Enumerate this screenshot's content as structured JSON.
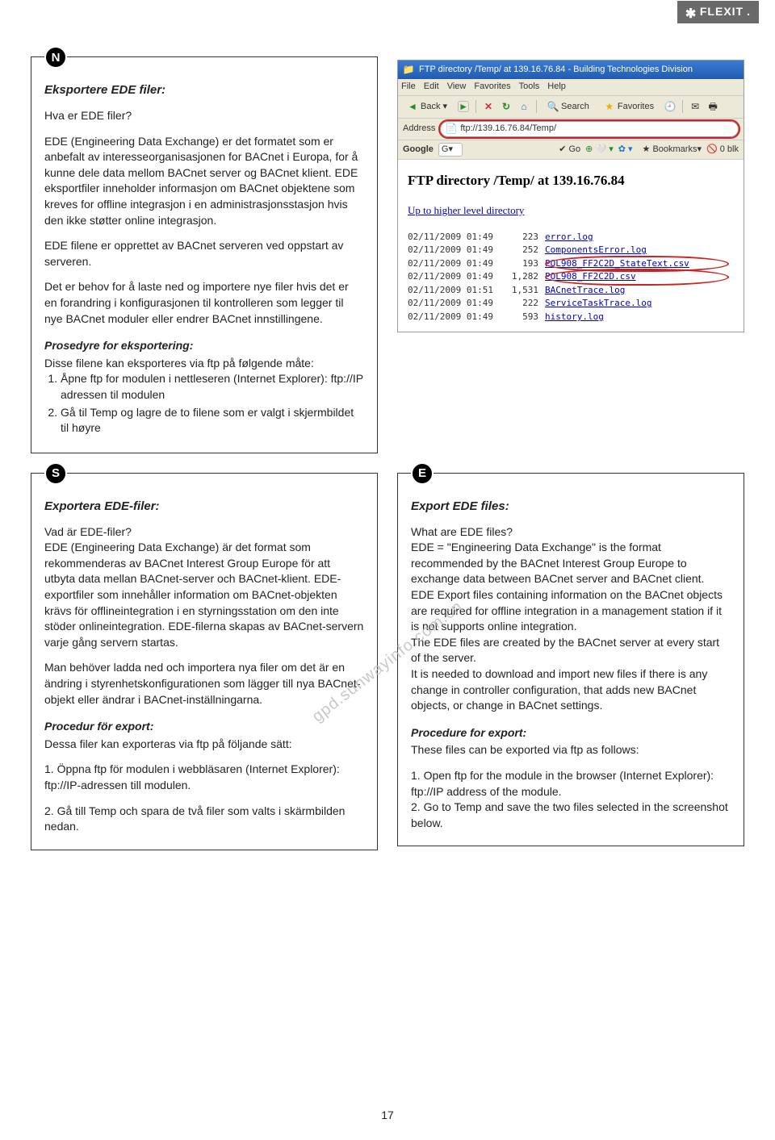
{
  "brand": "FLEXIT",
  "page_number": "17",
  "watermark": "gpd.sunwayinfo.com.cn",
  "sections": {
    "n": {
      "badge": "N",
      "title": "Eksportere EDE filer:",
      "q": "Hva er EDE filer?",
      "p1": "EDE (Engineering Data Exchange) er det formatet som er anbefalt av interesseorganisasjonen for BACnet i Europa, for å kunne dele data mellom BACnet server og BACnet klient. EDE eksportfiler inneholder informasjon om BACnet objektene som kreves for offline integrasjon i en administrasjonsstasjon hvis den ikke støtter online integrasjon.",
      "p2": "EDE filene er opprettet av BACnet serveren ved oppstart av serveren.",
      "p3": "Det er behov for å laste ned og importere nye filer hvis det er en forandring i konfigurasjonen til kontrolleren som legger til nye BACnet moduler eller endrer BACnet innstillingene.",
      "proc_head": "Prosedyre for eksportering:",
      "proc_intro": "Disse filene kan eksporteres via ftp på følgende måte:",
      "li1": "Åpne ftp for modulen i nettleseren (Internet Explorer): ftp://IP adressen til modulen",
      "li2": "Gå til Temp og lagre de to filene som er valgt i skjermbildet til høyre"
    },
    "s": {
      "badge": "S",
      "title": "Exportera EDE-filer:",
      "q": "Vad är EDE-filer?",
      "p1": "EDE (Engineering Data Exchange) är det format som rekommenderas av BACnet Interest Group Europe för att utbyta data mellan BACnet-server och BACnet-klient. EDE-exportfiler som innehåller information om BACnet-objekten krävs för offlineintegration i en styrningsstation om den inte stöder onlineintegration. EDE-filerna skapas av BACnet-servern varje gång servern startas.",
      "p2": "Man behöver ladda ned och importera nya filer om det är en ändring i styrenhetskonfigurationen som lägger till nya BACnet-objekt eller ändrar i BACnet-inställningarna.",
      "proc_head": "Procedur för export:",
      "proc_intro": "Dessa filer kan exporteras via ftp på följande sätt:",
      "li1": "1. Öppna ftp för modulen i webbläsaren (Internet Explorer): ftp://IP-adressen till modulen.",
      "li2": "2. Gå till Temp och spara de två filer som valts i skärmbilden nedan."
    },
    "e": {
      "badge": "E",
      "title": "Export EDE files:",
      "q": "What are EDE files?",
      "p1": "EDE = \"Engineering Data Exchange\" is the format recommended by the BACnet Interest Group Europe to exchange data between BACnet server and BACnet client.",
      "p2": "EDE Export files containing information on the BACnet objects are required for offline integration in a management station if it is not supports online integration.",
      "p3": "The EDE files are created by the BACnet server at every start of the server.",
      "p4": "It is needed to download and import new files if there is any change in controller configuration, that adds new BACnet objects, or change in BACnet settings.",
      "proc_head": "Procedure for export:",
      "proc_intro": "These files can be exported via ftp as follows:",
      "li1": "1. Open ftp for the module in the browser (Internet Explorer):",
      "li1b": "ftp://IP address of the module.",
      "li2": "2. Go to Temp and save the two files selected in the screenshot below."
    }
  },
  "screenshot": {
    "title": "FTP directory /Temp/ at 139.16.76.84 - Building Technologies Division",
    "menus": [
      "File",
      "Edit",
      "View",
      "Favorites",
      "Tools",
      "Help"
    ],
    "toolbar": {
      "back": "Back",
      "search": "Search",
      "favorites": "Favorites"
    },
    "address_label": "Address",
    "address": "ftp://139.16.76.84/Temp/",
    "google_label": "Google",
    "google_input": "G▾",
    "google_go": "Go",
    "google_bookmarks": "Bookmarks▾",
    "google_blocked": "0 blk",
    "body_title": "FTP directory /Temp/ at 139.16.76.84",
    "up_link": "Up to higher level directory",
    "rows": [
      {
        "date": "02/11/2009 01:49",
        "size": "223",
        "name": "error.log"
      },
      {
        "date": "02/11/2009 01:49",
        "size": "252",
        "name": "ComponentsError.log"
      },
      {
        "date": "02/11/2009 01:49",
        "size": "193",
        "name": "POL908_FF2C2D_StateText.csv"
      },
      {
        "date": "02/11/2009 01:49",
        "size": "1,282",
        "name": "POL908_FF2C2D.csv"
      },
      {
        "date": "02/11/2009 01:51",
        "size": "1,531",
        "name": "BACnetTrace.log"
      },
      {
        "date": "02/11/2009 01:49",
        "size": "222",
        "name": "ServiceTaskTrace.log"
      },
      {
        "date": "02/11/2009 01:49",
        "size": "593",
        "name": "history.log"
      }
    ],
    "highlight_rows": [
      2,
      3
    ]
  }
}
